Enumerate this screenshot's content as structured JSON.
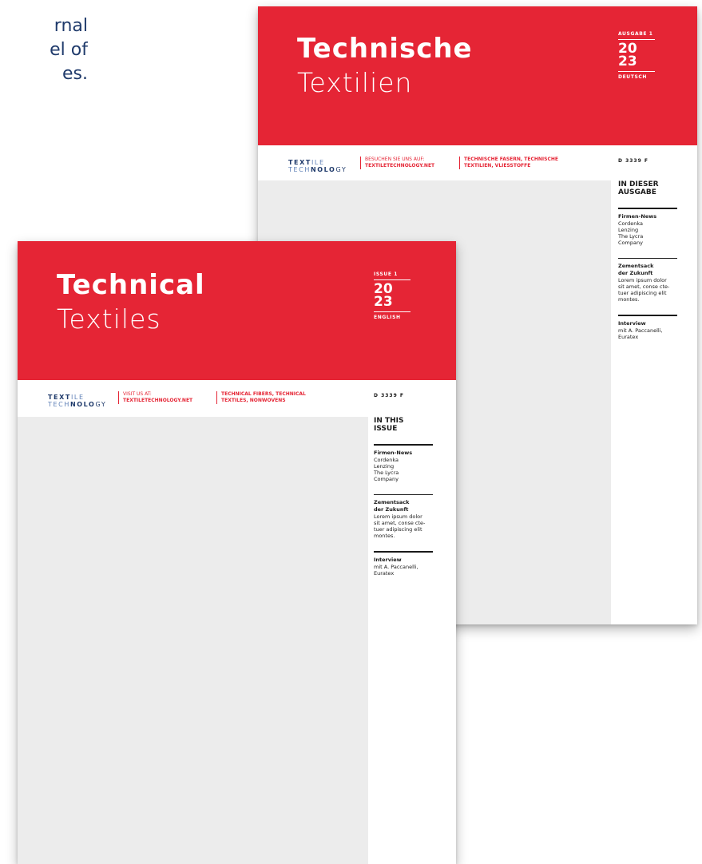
{
  "intro": {
    "lines": [
      "rnal",
      "el of",
      "es."
    ]
  },
  "brand": {
    "logo_line1_bold": "TEXT",
    "logo_line1_light": "ILE",
    "logo_line2_light": "TECH",
    "logo_line2_bold": "NOLO",
    "logo_line2_end": "GY"
  },
  "covers": {
    "de": {
      "title_main": "Technische",
      "title_sub": "Textilien",
      "issue_label": "AUSGABE 1",
      "year_top": "20",
      "year_bottom": "23",
      "language": "DEUTSCH",
      "visit_label": "BESUCHEN SIE UNS AUF:",
      "visit_url": "TEXTILETECHNOLOGY.NET",
      "topics_line1": "TECHNISCHE FASERN, TECHNISCHE",
      "topics_line2": "TEXTILIEN, VLIESSTOFFE",
      "doc_code": "D 3339 F",
      "toc_title_1": "IN DIESER",
      "toc_title_2": "AUSGABE",
      "sections": [
        {
          "head": "Firmen-News",
          "body": [
            "Cordenka",
            "Lenzing",
            "The Lycra",
            "Company"
          ]
        },
        {
          "head": "Zementsack der Zukunft",
          "head_lines": [
            "Zementsack",
            "der Zukunft"
          ],
          "body": [
            "Lorem ipsum dolor",
            "sit amet, conse cte-",
            "tuer adipiscing elit",
            "montes."
          ]
        },
        {
          "head": "Interview",
          "body": [
            "mit A. Paccanelli,",
            "Euratex"
          ]
        }
      ]
    },
    "en": {
      "title_main": "Technical",
      "title_sub": "Textiles",
      "issue_label": "ISSUE 1",
      "year_top": "20",
      "year_bottom": "23",
      "language": "ENGLISH",
      "visit_label": "VISIT US AT:",
      "visit_url": "TEXTILETECHNOLOGY.NET",
      "topics_line1": "TECHNICAL FIBERS, TECHNICAL",
      "topics_line2": "TEXTILES, NONWOVENS",
      "doc_code": "D 3339 F",
      "toc_title_1": "IN THIS",
      "toc_title_2": "ISSUE",
      "sections": [
        {
          "head": "Firmen-News",
          "body": [
            "Cordenka",
            "Lenzing",
            "The Lycra",
            "Company"
          ]
        },
        {
          "head": "Zementsack der Zukunft",
          "head_lines": [
            "Zementsack",
            "der Zukunft"
          ],
          "body": [
            "Lorem ipsum dolor",
            "sit amet, conse cte-",
            "tuer adipiscing elit",
            "montes."
          ]
        },
        {
          "head": "Interview",
          "body": [
            "mit A. Paccanelli,",
            "Euratex"
          ]
        }
      ]
    }
  },
  "colors": {
    "brand_red": "#e52535",
    "brand_blue": "#1f3a6b",
    "photo_gray": "#ececec"
  }
}
